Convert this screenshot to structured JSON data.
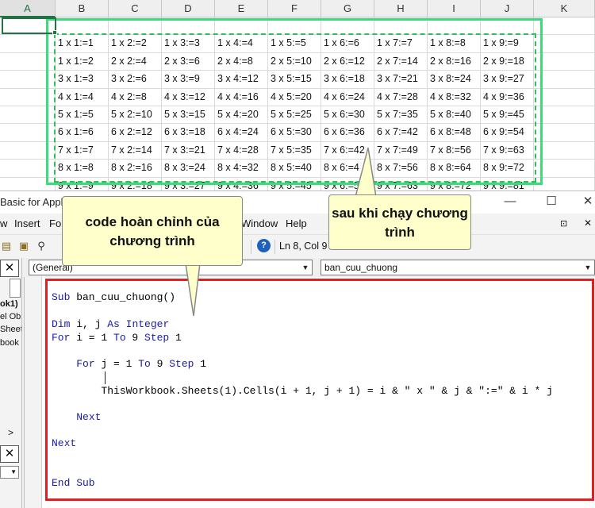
{
  "excel": {
    "columns": [
      "A",
      "B",
      "C",
      "D",
      "E",
      "F",
      "G",
      "H",
      "I",
      "J",
      "K"
    ],
    "table": [
      [
        "1 x 1:=1",
        "1 x 2:=2",
        "1 x 3:=3",
        "1 x 4:=4",
        "1 x 5:=5",
        "1 x 6:=6",
        "1 x 7:=7",
        "1 x 8:=8",
        "1 x 9:=9"
      ],
      [
        "1 x 1:=2",
        "2 x 2:=4",
        "2 x 3:=6",
        "2 x 4:=8",
        "2 x 5:=10",
        "2 x 6:=12",
        "2 x 7:=14",
        "2 x 8:=16",
        "2 x 9:=18"
      ],
      [
        "3 x 1:=3",
        "3 x 2:=6",
        "3 x 3:=9",
        "3 x 4:=12",
        "3 x 5:=15",
        "3 x 6:=18",
        "3 x 7:=21",
        "3 x 8:=24",
        "3 x 9:=27"
      ],
      [
        "4 x 1:=4",
        "4 x 2:=8",
        "4 x 3:=12",
        "4 x 4:=16",
        "4 x 5:=20",
        "4 x 6:=24",
        "4 x 7:=28",
        "4 x 8:=32",
        "4 x 9:=36"
      ],
      [
        "5 x 1:=5",
        "5 x 2:=10",
        "5 x 3:=15",
        "5 x 4:=20",
        "5 x 5:=25",
        "5 x 6:=30",
        "5 x 7:=35",
        "5 x 8:=40",
        "5 x 9:=45"
      ],
      [
        "6 x 1:=6",
        "6 x 2:=12",
        "6 x 3:=18",
        "6 x 4:=24",
        "6 x 5:=30",
        "6 x 6:=36",
        "6 x 7:=42",
        "6 x 8:=48",
        "6 x 9:=54"
      ],
      [
        "7 x 1:=7",
        "7 x 2:=14",
        "7 x 3:=21",
        "7 x 4:=28",
        "7 x 5:=35",
        "7 x 6:=42",
        "7 x 7:=49",
        "7 x 8:=56",
        "7 x 9:=63"
      ],
      [
        "8 x 1:=8",
        "8 x 2:=16",
        "8 x 3:=24",
        "8 x 4:=32",
        "8 x 5:=40",
        "8 x 6:=4",
        "8 x 7:=56",
        "8 x 8:=64",
        "8 x 9:=72"
      ],
      [
        "9 x 1:=9",
        "9 x 2:=18",
        "9 x 3:=27",
        "9 x 4:=36",
        "9 x 5:=45",
        "9 x 6:=5",
        "9 x 7:=63",
        "9 x 8:=72",
        "9 x 9:=81"
      ]
    ]
  },
  "vba": {
    "title": "Basic for Appli",
    "window_buttons": {
      "minimize": "—",
      "maximize": "☐",
      "close": "✕"
    },
    "menu": {
      "view": "w",
      "insert": "Insert",
      "format": "Fo",
      "window": "Window",
      "help": "Help"
    },
    "toolbar": {
      "position": "Ln 8, Col 9"
    },
    "object_combo": "(General)",
    "procedure_combo": "ban_cuu_chuong",
    "project_pane": {
      "line1": "ok1)",
      "line2": "el Ob",
      "line3": "Sheet",
      "line4": "book",
      "arrow": ">"
    },
    "code": {
      "sub_keyword": "Sub",
      "sub_name": " ban_cuu_chuong()",
      "dim_keyword": "Dim",
      "dim_vars": " i, j ",
      "as_keyword": "As",
      "sp": " ",
      "integer_keyword": "Integer",
      "for_keyword": "For",
      "for_i_mid": " i = 1 ",
      "to_keyword": "To",
      "for_i_end": " 9 ",
      "step_keyword": "Step",
      "step_val": " 1",
      "indent1": "    ",
      "for_j_mid": " j = 1 ",
      "indent2": "        ",
      "body": "ThisWorkbook.Sheets(1).Cells(i + 1, j + 1) = i & \" x \" & j & \":=\" & i * j",
      "next_keyword": "Next",
      "end_sub": "End Sub"
    }
  },
  "callouts": {
    "code_complete": "code hoàn chỉnh của chương trình",
    "after_run": "sau khi chạy chương trình"
  },
  "colors": {
    "excel_green": "#217346",
    "frame_green": "#3ddc7a",
    "frame_red": "#e02020",
    "callout_fill": "#ffffcc",
    "vba_keyword": "#1a1aa6"
  }
}
